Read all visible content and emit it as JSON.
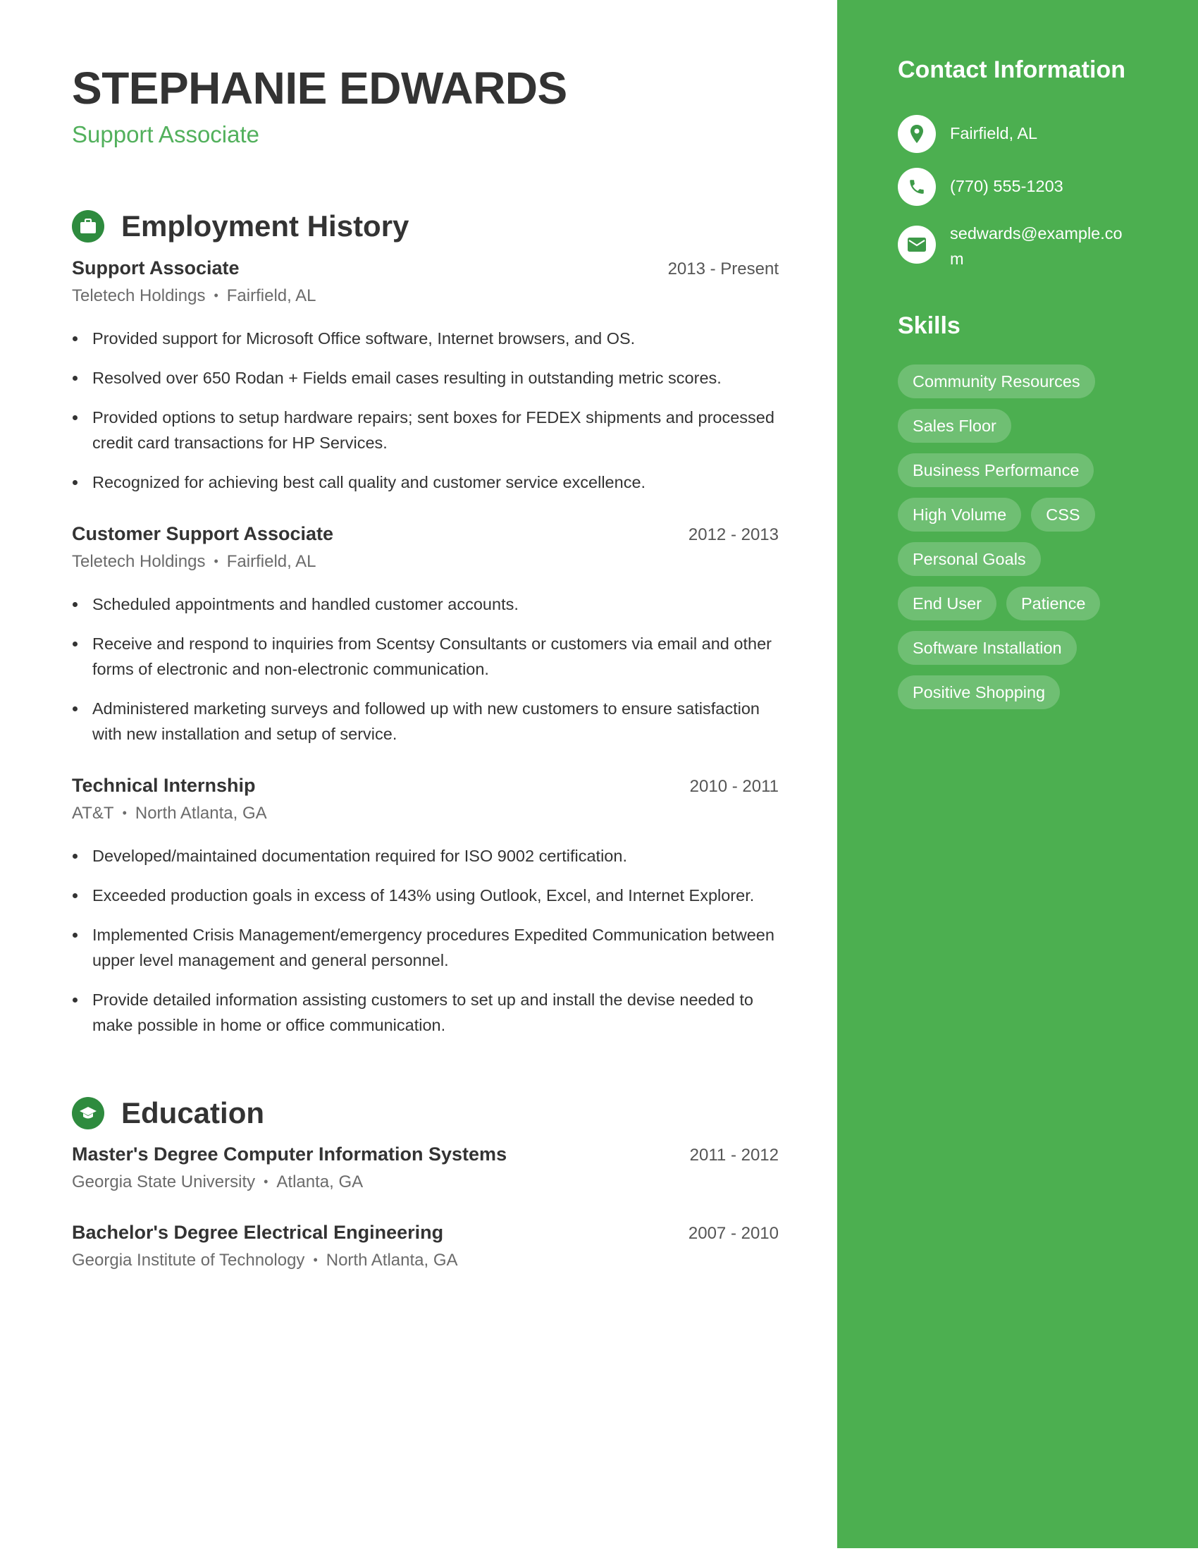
{
  "header": {
    "name": "STEPHANIE EDWARDS",
    "title": "Support Associate"
  },
  "employment": {
    "heading": "Employment History",
    "icon": "briefcase-icon",
    "jobs": [
      {
        "title": "Support Associate",
        "dates": "2013 - Present",
        "company": "Teletech Holdings",
        "location": "Fairfield, AL",
        "bullets": [
          "Provided support for Microsoft Office software, Internet browsers, and OS.",
          "Resolved over 650 Rodan + Fields email cases resulting in outstanding metric scores.",
          "Provided options to setup hardware repairs; sent boxes for FEDEX shipments and processed credit card transactions for HP Services.",
          "Recognized for achieving best call quality and customer service excellence."
        ]
      },
      {
        "title": "Customer Support Associate",
        "dates": "2012 - 2013",
        "company": "Teletech Holdings",
        "location": "Fairfield, AL",
        "bullets": [
          "Scheduled appointments and handled customer accounts.",
          "Receive and respond to inquiries from Scentsy Consultants or customers via email and other forms of electronic and non-electronic communication.",
          "Administered marketing surveys and followed up with new customers to ensure satisfaction with new installation and setup of service."
        ]
      },
      {
        "title": "Technical Internship",
        "dates": "2010 - 2011",
        "company": "AT&T",
        "location": "North Atlanta, GA",
        "bullets": [
          "Developed/maintained documentation required for ISO 9002 certification.",
          "Exceeded production goals in excess of 143% using Outlook, Excel, and Internet Explorer.",
          "Implemented Crisis Management/emergency procedures Expedited Communication between upper level management and general personnel.",
          "Provide detailed information assisting customers to set up and install the devise needed to make possible in home or office communication."
        ]
      }
    ]
  },
  "education": {
    "heading": "Education",
    "icon": "graduation-cap-icon",
    "items": [
      {
        "degree": "Master's Degree Computer Information Systems",
        "dates": "2011 - 2012",
        "school": "Georgia State University",
        "location": "Atlanta, GA"
      },
      {
        "degree": "Bachelor's Degree Electrical Engineering",
        "dates": "2007 - 2010",
        "school": "Georgia Institute of Technology",
        "location": "North Atlanta, GA"
      }
    ]
  },
  "sidebar": {
    "contact_heading": "Contact Information",
    "contact": [
      {
        "icon": "location-pin-icon",
        "text": "Fairfield, AL"
      },
      {
        "icon": "phone-icon",
        "text": "(770) 555-1203"
      },
      {
        "icon": "email-icon",
        "text": "sedwards@example.com"
      }
    ],
    "skills_heading": "Skills",
    "skills": [
      "Community Resources",
      "Sales Floor",
      "Business Performance",
      "High Volume",
      "CSS",
      "Personal Goals",
      "End User",
      "Patience",
      "Software Installation",
      "Positive Shopping"
    ]
  },
  "colors": {
    "accent": "#4caf50",
    "icon_green": "#2e8b3e",
    "subtitle_green": "#52b05c",
    "text": "#333333"
  },
  "separator": "•"
}
